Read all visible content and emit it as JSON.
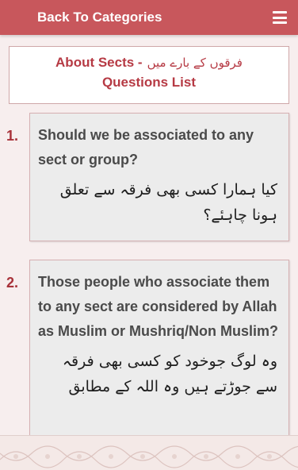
{
  "topbar": {
    "back_label": "Back To Categories",
    "menu_icon": "hamburger-menu-icon"
  },
  "header": {
    "title_en": "About Sects - ",
    "title_ur": "فرقوں کے بارے میں",
    "subtitle": "Questions List"
  },
  "questions": [
    {
      "number": "1.",
      "english": "Should we be associated to any sect or group?",
      "urdu": "کیا ہمارا کسی بھی فرقہ سے تعلق ہونا چاہئے؟"
    },
    {
      "number": "2.",
      "english": "Those people who associate them to any sect are considered by Allah as Muslim or Mushriq/Non Muslim?",
      "urdu": "وہ لوگ جوخود کو کسی بھی فرقہ سے جوڑتے ہیں وہ اللہ کے مطابق"
    }
  ],
  "colors": {
    "accent": "#c8575c",
    "number": "#a8323a",
    "card_bg": "#ececec"
  }
}
